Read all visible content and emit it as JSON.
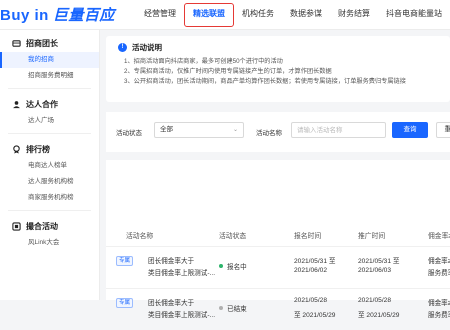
{
  "header": {
    "logo_en": "Buy in",
    "logo_cn": "巨量百应",
    "nav": [
      {
        "label": "经营管理",
        "active": false
      },
      {
        "label": "精选联盟",
        "active": true
      },
      {
        "label": "机构任务",
        "active": false
      },
      {
        "label": "数据参谋",
        "active": false
      },
      {
        "label": "财务结算",
        "active": false
      },
      {
        "label": "抖音电商能量站",
        "active": false
      }
    ]
  },
  "sidebar": {
    "groups": [
      {
        "title": "招商团长",
        "icon": "merchant-icon",
        "items": [
          {
            "label": "我的招商",
            "active": true
          },
          {
            "label": "招商服务费明细",
            "active": false
          }
        ]
      },
      {
        "title": "达人合作",
        "icon": "creator-icon",
        "items": [
          {
            "label": "达人广场",
            "active": false
          }
        ]
      },
      {
        "title": "排行榜",
        "icon": "ranking-icon",
        "items": [
          {
            "label": "电商达人榜单",
            "active": false
          },
          {
            "label": "达人服务机构榜",
            "active": false
          },
          {
            "label": "商家服务机构榜",
            "active": false
          }
        ]
      },
      {
        "title": "撮合活动",
        "icon": "matching-icon",
        "items": [
          {
            "label": "风Link大会",
            "active": false
          }
        ]
      }
    ]
  },
  "notice": {
    "title": "活动说明",
    "lines": [
      "1、招商活动面向抖店商家，最多可创建50个进行中的活动",
      "2、专属招商活动，仅推广时间内使用专属链接产生的订单，才算作团长数据",
      "3、公开招商活动，团长活动期间，商品产单均算作团长数据；若使用专属链接，订单服务费归专属链接"
    ]
  },
  "filter": {
    "status_label": "活动状态",
    "status_value": "全部",
    "name_label": "活动名称",
    "name_placeholder": "请输入活动名称",
    "search_button": "查询",
    "reset_button": "重置"
  },
  "table": {
    "headers": [
      "活动名称",
      "活动状态",
      "报名时间",
      "推广时间",
      "佣金率≥"
    ],
    "rows": [
      {
        "tag": "专属",
        "name_line1": "团长佣金率大于",
        "name_line2": "类目佣金率上限测试-...",
        "status": "报名中",
        "status_color": "#2db46b",
        "signup_line1": "2021/05/31 至",
        "signup_line2": "2021/06/02",
        "promo_line1": "2021/05/31 至",
        "promo_line2": "2021/06/03",
        "more_line1": "佣金率≥",
        "more_line2": "服务费率"
      },
      {
        "tag": "专属",
        "name_line1": "团长佣金率大于",
        "name_line2": "类目佣金率上限测试-...",
        "status": "已结束",
        "status_color": "#b0b0b0",
        "signup_line1": "2021/05/28",
        "signup_line2": "至 2021/05/29",
        "promo_line1": "2021/05/28",
        "promo_line2": "至 2021/05/29",
        "more_line1": "佣金率≥",
        "more_line2": "服务费率"
      }
    ]
  },
  "colors": {
    "brand": "#1966ff",
    "highlight_border": "#e53935"
  }
}
